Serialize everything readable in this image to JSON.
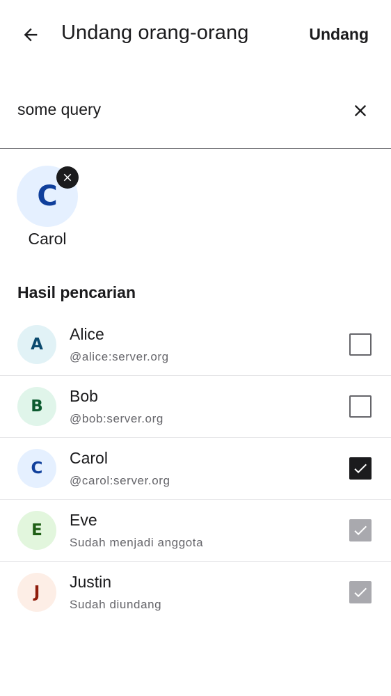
{
  "header": {
    "title": "Undang orang-orang",
    "action_label": "Undang"
  },
  "search": {
    "value": "some query"
  },
  "selected": [
    {
      "initial": "C",
      "name": "Carol"
    }
  ],
  "results": {
    "section_title": "Hasil pencarian",
    "items": [
      {
        "initial": "A",
        "name": "Alice",
        "subtitle": "@alice:server.org",
        "state": "unchecked",
        "avatar_bg": "#e1f2f6",
        "avatar_fg": "#0b4a6e"
      },
      {
        "initial": "B",
        "name": "Bob",
        "subtitle": "@bob:server.org",
        "state": "unchecked",
        "avatar_bg": "#e0f5ea",
        "avatar_fg": "#0b5a2f"
      },
      {
        "initial": "C",
        "name": "Carol",
        "subtitle": "@carol:server.org",
        "state": "checked",
        "avatar_bg": "#e5f0ff",
        "avatar_fg": "#0f3f9c"
      },
      {
        "initial": "E",
        "name": "Eve",
        "subtitle": "Sudah menjadi anggota",
        "state": "disabled",
        "avatar_bg": "#e2f6dd",
        "avatar_fg": "#1f5f16"
      },
      {
        "initial": "J",
        "name": "Justin",
        "subtitle": "Sudah diundang",
        "state": "disabled",
        "avatar_bg": "#fdeee6",
        "avatar_fg": "#8f1d0c"
      }
    ]
  },
  "colors": {
    "text_primary": "#1b1b1d",
    "text_secondary": "#65656a",
    "divider": "#e6e6e8",
    "checkbox_disabled": "#a9a9ae"
  }
}
